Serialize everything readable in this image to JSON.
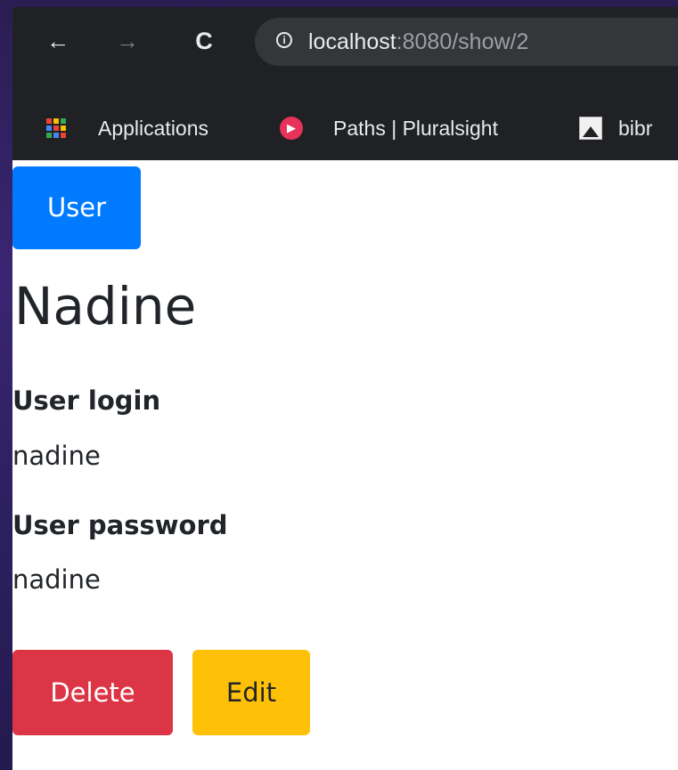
{
  "browser": {
    "back_glyph": "←",
    "forward_glyph": "→",
    "reload_glyph": "C",
    "info_glyph": "i",
    "url_host": "localhost",
    "url_rest": ":8080/show/2"
  },
  "bookmarks": [
    {
      "label": "Applications",
      "icon": "apps-grid-icon"
    },
    {
      "label": "Paths | Pluralsight",
      "icon": "pluralsight-icon"
    },
    {
      "label": "bibr",
      "icon": "bookmark-favicon-icon"
    }
  ],
  "page": {
    "user_button": "User",
    "name_heading": "Nadine",
    "login_label": "User login",
    "login_value": "nadine",
    "password_label": "User password",
    "password_value": "nadine",
    "delete_button": "Delete",
    "edit_button": "Edit"
  },
  "colors": {
    "primary": "#007bff",
    "danger": "#dc3545",
    "warning": "#ffc107",
    "chrome_dark": "#202124",
    "desktop": "#2a1d52"
  }
}
